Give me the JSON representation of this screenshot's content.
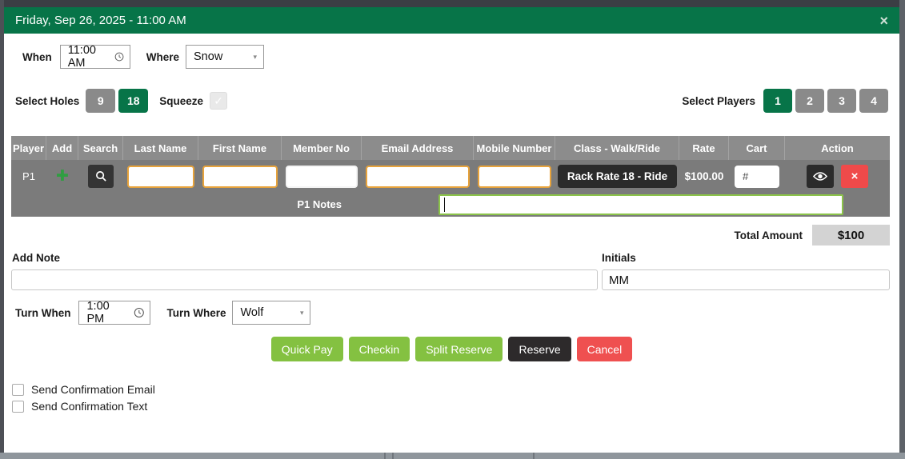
{
  "modal": {
    "title": "Friday, Sep 26, 2025 - 11:00 AM",
    "close_icon": "×"
  },
  "when": {
    "label": "When",
    "value": "11:00 AM"
  },
  "where": {
    "label": "Where",
    "value": "Snow"
  },
  "holes": {
    "label": "Select Holes",
    "options": [
      "9",
      "18"
    ],
    "selected": "18"
  },
  "squeeze": {
    "label": "Squeeze",
    "checked": true,
    "check_icon": "✓"
  },
  "players": {
    "label": "Select Players",
    "options": [
      "1",
      "2",
      "3",
      "4"
    ],
    "selected": "1"
  },
  "table": {
    "headers": [
      "Player",
      "Add",
      "Search",
      "Last Name",
      "First Name",
      "Member No",
      "Email Address",
      "Mobile Number",
      "Class - Walk/Ride",
      "Rate",
      "Cart",
      "Action"
    ],
    "row": {
      "player": "P1",
      "add_icon": "✚",
      "last_name": "",
      "first_name": "",
      "member_no": "",
      "email": "",
      "mobile": "",
      "class_button": "Rack Rate 18 - Ride",
      "rate": "$100.00",
      "cart_placeholder": "#",
      "delete_icon": "×"
    },
    "notes": {
      "label": "P1 Notes",
      "value": ""
    }
  },
  "total": {
    "label": "Total Amount",
    "value": "$100"
  },
  "add_note": {
    "label": "Add Note",
    "value": ""
  },
  "initials": {
    "label": "Initials",
    "value": "MM"
  },
  "turn_when": {
    "label": "Turn When",
    "value": "1:00 PM"
  },
  "turn_where": {
    "label": "Turn Where",
    "value": "Wolf"
  },
  "actions": {
    "quick_pay": "Quick Pay",
    "checkin": "Checkin",
    "split_reserve": "Split Reserve",
    "reserve": "Reserve",
    "cancel": "Cancel"
  },
  "confirmations": [
    {
      "label": "Send Confirmation Email",
      "checked": false
    },
    {
      "label": "Send Confirmation Text",
      "checked": false
    }
  ],
  "icons": {
    "caret": "▾"
  },
  "colors": {
    "header_green": "#077448",
    "selected_green": "#077448",
    "gray_button": "#8a8a8a",
    "table_header": "#8c8c8c",
    "table_row": "#7b7b7b",
    "orange_border": "#e7a33c",
    "notes_border": "#8bc34a",
    "dark_button": "#2b2b2b",
    "action_green": "#84c141",
    "action_red": "#ef5050",
    "total_box": "#d3d3d3"
  }
}
